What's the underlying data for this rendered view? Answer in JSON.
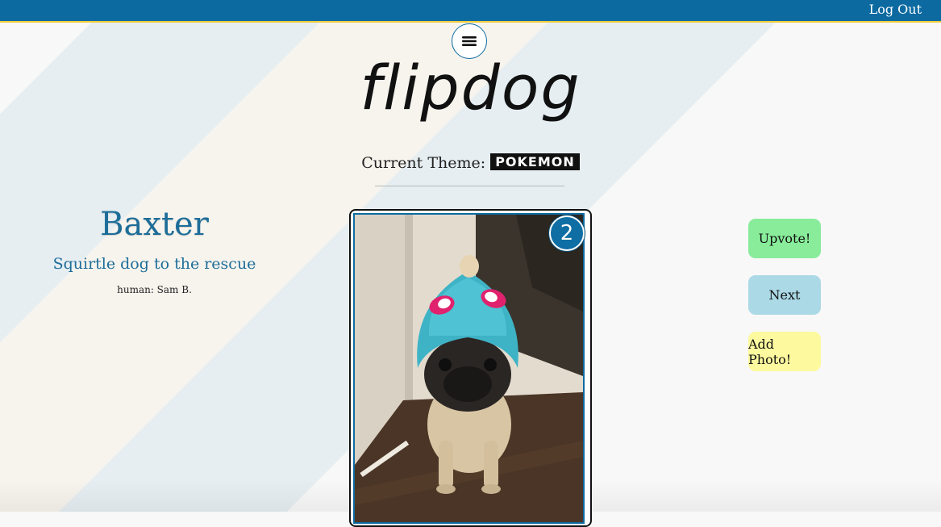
{
  "header": {
    "logout_label": "Log Out"
  },
  "brand": {
    "logo_text": "flipdog"
  },
  "theme": {
    "label": "Current Theme:",
    "value": "POKEMON"
  },
  "dog": {
    "name": "Baxter",
    "caption": "Squirtle dog to the rescue",
    "human": "human: Sam B.",
    "votes": "2"
  },
  "actions": {
    "upvote_label": "Upvote!",
    "next_label": "Next",
    "add_photo_label": "Add Photo!"
  },
  "icons": {
    "menu": "hamburger-menu-icon",
    "photo": "dog-photo"
  },
  "colors": {
    "topbar": "#0c6aa1",
    "topbar_accent": "#f0cc3a",
    "name_text": "#1d6d99",
    "upvote": "#88ec9a",
    "next": "#abd9e6",
    "add_photo": "#fdf99e"
  }
}
